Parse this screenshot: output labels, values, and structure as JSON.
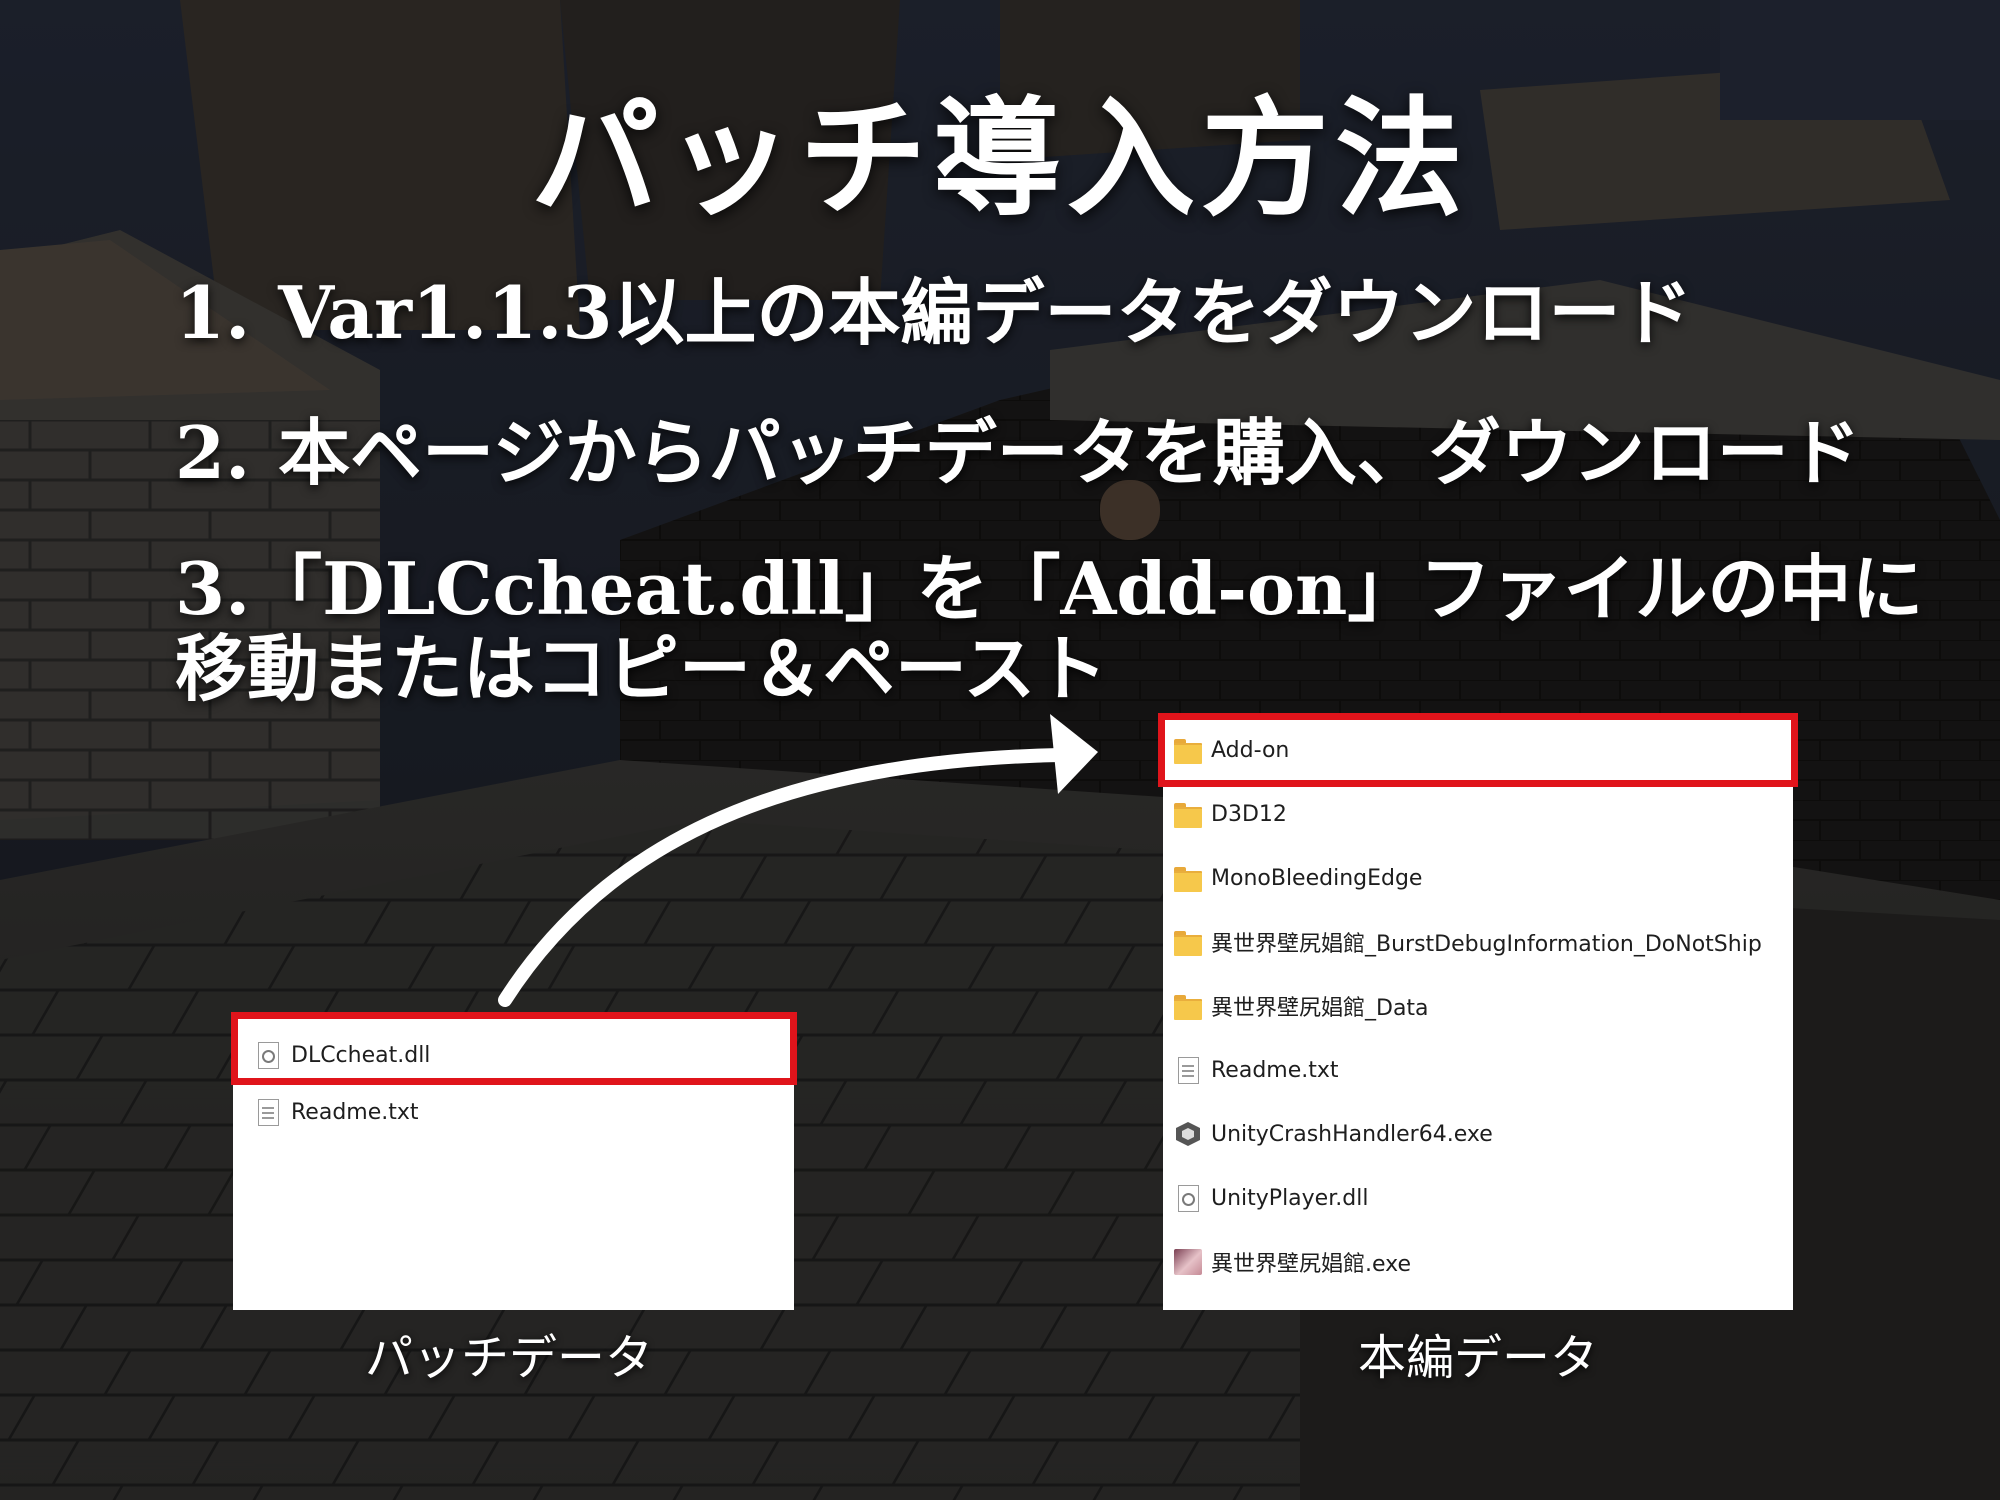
{
  "title": "パッチ導入方法",
  "steps": [
    {
      "num": "1.",
      "text": "Var1.1.3以上の本編データをダウンロード"
    },
    {
      "num": "2.",
      "text": "本ページからパッチデータを購入、ダウンロード"
    },
    {
      "num": "3.",
      "text": "「DLCcheat.dll」を「Add-on」ファイルの中に",
      "text2": "移動またはコピー＆ペースト"
    }
  ],
  "patch_panel": {
    "caption": "パッチデータ",
    "files": [
      {
        "name": "DLCcheat.dll",
        "icon": "dll-file-icon",
        "highlighted": true
      },
      {
        "name": "Readme.txt",
        "icon": "text-file-icon",
        "highlighted": false
      }
    ]
  },
  "main_panel": {
    "caption": "本編データ",
    "files": [
      {
        "name": "Add-on",
        "icon": "folder-icon",
        "highlighted": true
      },
      {
        "name": "D3D12",
        "icon": "folder-icon",
        "highlighted": false
      },
      {
        "name": "MonoBleedingEdge",
        "icon": "folder-icon",
        "highlighted": false
      },
      {
        "name": "異世界壁尻娼館_BurstDebugInformation_DoNotShip",
        "icon": "folder-icon",
        "highlighted": false
      },
      {
        "name": "異世界壁尻娼館_Data",
        "icon": "folder-icon",
        "highlighted": false
      },
      {
        "name": "Readme.txt",
        "icon": "text-file-icon",
        "highlighted": false
      },
      {
        "name": "UnityCrashHandler64.exe",
        "icon": "unity-icon",
        "highlighted": false
      },
      {
        "name": "UnityPlayer.dll",
        "icon": "dll-file-icon",
        "highlighted": false
      },
      {
        "name": "異世界壁尻娼館.exe",
        "icon": "app-icon",
        "highlighted": false
      }
    ]
  },
  "colors": {
    "highlight": "#e0141b",
    "text": "#ffffff",
    "arrow": "#ffffff"
  }
}
